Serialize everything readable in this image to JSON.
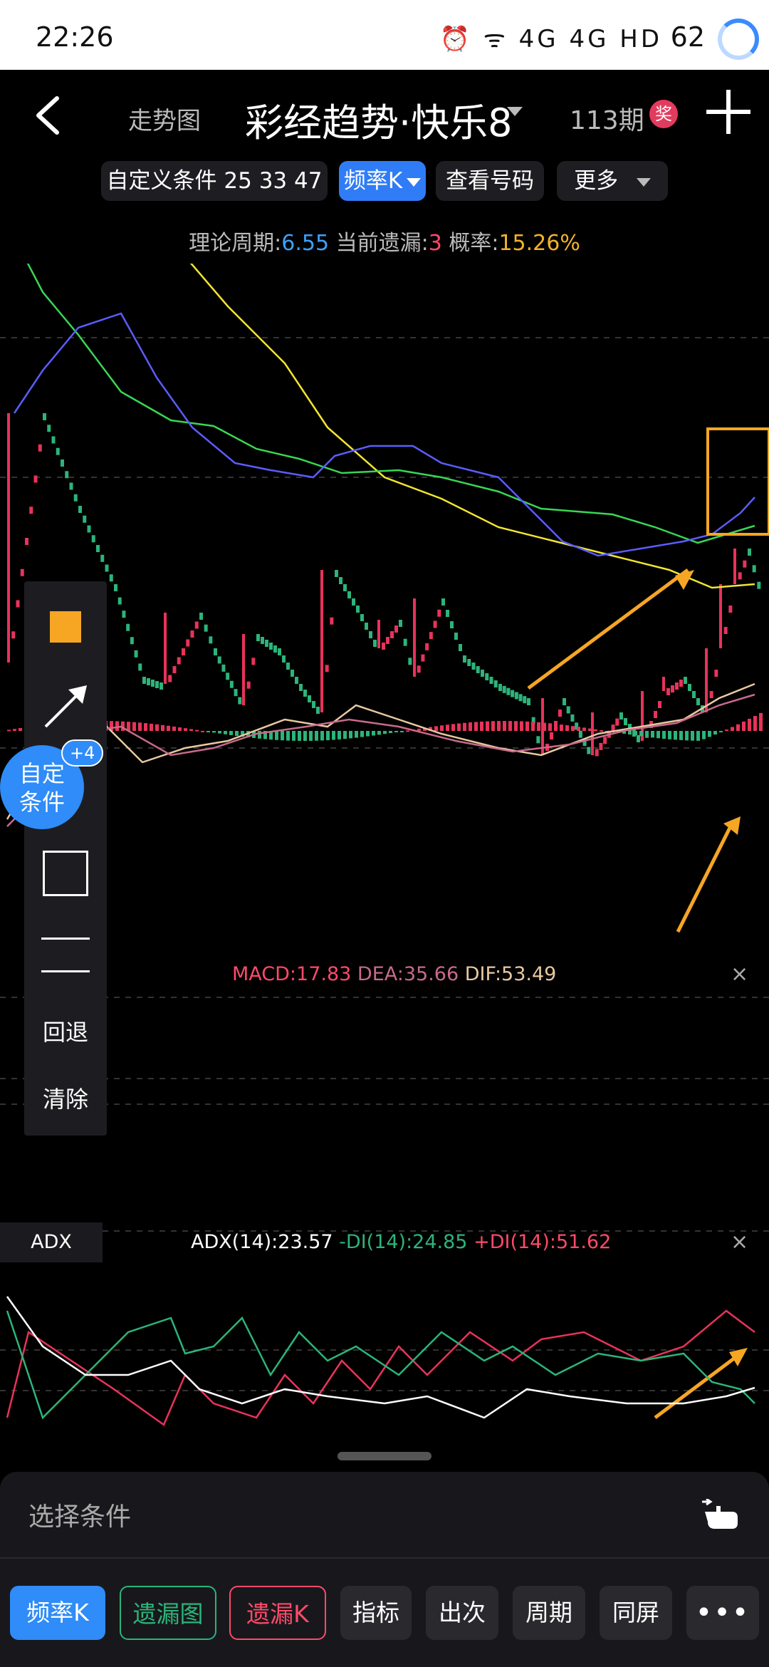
{
  "status_bar": {
    "time": "22:26",
    "icons": "⏰ ᯤ 4G 4G HD",
    "battery": "62"
  },
  "header": {
    "nav_tab": "走势图",
    "title": "彩经趋势·快乐8",
    "period": "113期",
    "award_badge": "奖"
  },
  "filters": {
    "custom_condition": "自定义条件 25 33 47",
    "frequency_k": "频率K",
    "view_numbers": "查看号码",
    "more": "更多"
  },
  "theory": {
    "cycle_label": "理论周期:",
    "cycle_value": "6.55",
    "missing_label": " 当前遗漏:",
    "missing_value": "3",
    "prob_label": " 概率:",
    "prob_value": "15.26%"
  },
  "macd_legend": {
    "macd": "MACD:17.83",
    "dea": "DEA:35.66",
    "dif": "DIF:53.49"
  },
  "adx_panel": {
    "tag": "ADX",
    "adx": "ADX(14):23.57",
    "minus_di": " -DI(14):24.85",
    "plus_di": " +DI(14):51.62"
  },
  "close_symbol": "×",
  "drawing_toolbar": {
    "undo": "回退",
    "clear": "清除"
  },
  "fab": {
    "line1": "自定",
    "line2": "条件",
    "badge": "+4"
  },
  "bottom_panel": {
    "select_condition": "选择条件",
    "buttons": [
      "频率K",
      "遗漏图",
      "遗漏K",
      "指标",
      "出次",
      "周期",
      "同屏",
      "•••"
    ]
  },
  "colors": {
    "accent_blue": "#2f8cf8",
    "candle_up": "#e8335a",
    "candle_down": "#2cb47a",
    "ma_yellow": "#f2e530",
    "ma_green": "#39d653",
    "ma_blue": "#5b5cff",
    "highlight_orange": "#f6a623"
  }
}
